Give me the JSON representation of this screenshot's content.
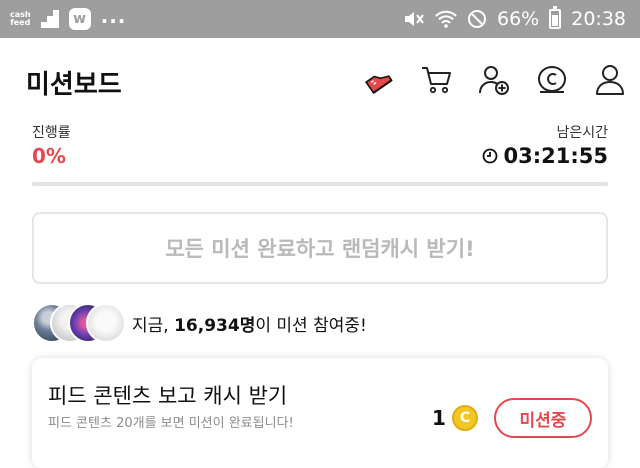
{
  "status_bar": {
    "app_logo_text": "cash\nfeed",
    "app_badge_letter": "w",
    "more_dots": "...",
    "battery_percent": "66%",
    "battery_level": 0.66,
    "time": "20:38",
    "icons": [
      "mute-icon",
      "wifi-icon",
      "do-not-disturb-icon",
      "battery-icon"
    ]
  },
  "header": {
    "title": "미션보드",
    "icons": [
      "red-sneaker-icon",
      "cart-icon",
      "add-friend-icon",
      "cash-coin-icon",
      "profile-icon"
    ]
  },
  "progress": {
    "label": "진행률",
    "value": "0%",
    "fraction": 0,
    "remaining_label": "남은시간",
    "remaining_value": "03:21:55"
  },
  "reward_banner": {
    "text": "모든 미션 완료하고 랜덤캐시 받기!"
  },
  "participants": {
    "prefix": "지금, ",
    "count": "16,934명",
    "suffix": "이 미션 참여중!"
  },
  "mission": {
    "title": "피드 콘텐츠 보고 캐시 받기",
    "description": "피드 콘텐츠 20개를 보면 미션이 완료됩니다!",
    "reward_count": "1",
    "coin_symbol": "C",
    "button_label": "미션중"
  },
  "colors": {
    "accent": "#e5484d",
    "status_bar": "#9e9e9e",
    "coin": "#f3c623"
  }
}
